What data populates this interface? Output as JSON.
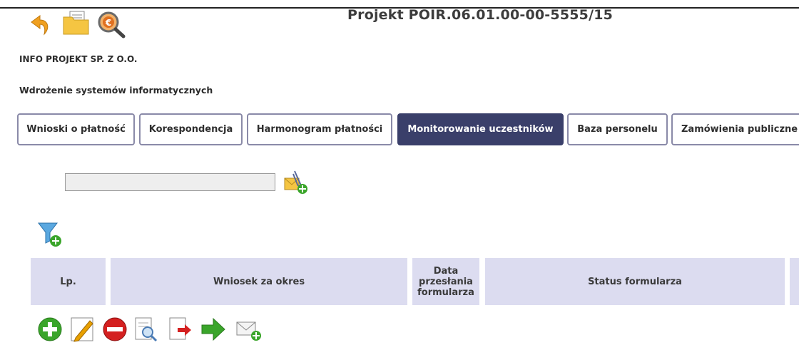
{
  "header": {
    "title": "Projekt POIR.06.01.00-00-5555/15",
    "toolbar": [
      {
        "icon": "back-arrow-icon",
        "color": "#f0a020"
      },
      {
        "icon": "folder-document-icon",
        "color": "#f5c542"
      },
      {
        "icon": "euro-magnifier-icon",
        "color": "#e07020"
      }
    ]
  },
  "company": "INFO PROJEKT SP. Z O.O.",
  "project_name": "Wdrożenie systemów informatycznych",
  "tabs": [
    {
      "label": "Wnioski o płatność",
      "active": false
    },
    {
      "label": "Korespondencja",
      "active": false
    },
    {
      "label": "Harmonogram płatności",
      "active": false
    },
    {
      "label": "Monitorowanie uczestników",
      "active": true
    },
    {
      "label": "Baza personelu",
      "active": false
    },
    {
      "label": "Zamówienia publiczne",
      "active": false
    }
  ],
  "search": {
    "value": "",
    "placeholder": ""
  },
  "table": {
    "columns": [
      "Lp.",
      "Wniosek za okres",
      "Data\nprzesłania\nformularza",
      "Status formularza"
    ]
  },
  "actions": [
    {
      "icon": "add-icon",
      "color": "#3aa52a"
    },
    {
      "icon": "edit-icon",
      "color": "#e8a000"
    },
    {
      "icon": "remove-icon",
      "color": "#d42020"
    },
    {
      "icon": "preview-icon",
      "color": "#4a7bb5"
    },
    {
      "icon": "export-icon",
      "color": "#d42020"
    },
    {
      "icon": "forward-arrow-icon",
      "color": "#3aa52a"
    },
    {
      "icon": "new-message-icon",
      "color": "#3aa52a"
    }
  ],
  "colors": {
    "accent": "#3a3f6a",
    "table_header": "#dcdcf0"
  }
}
